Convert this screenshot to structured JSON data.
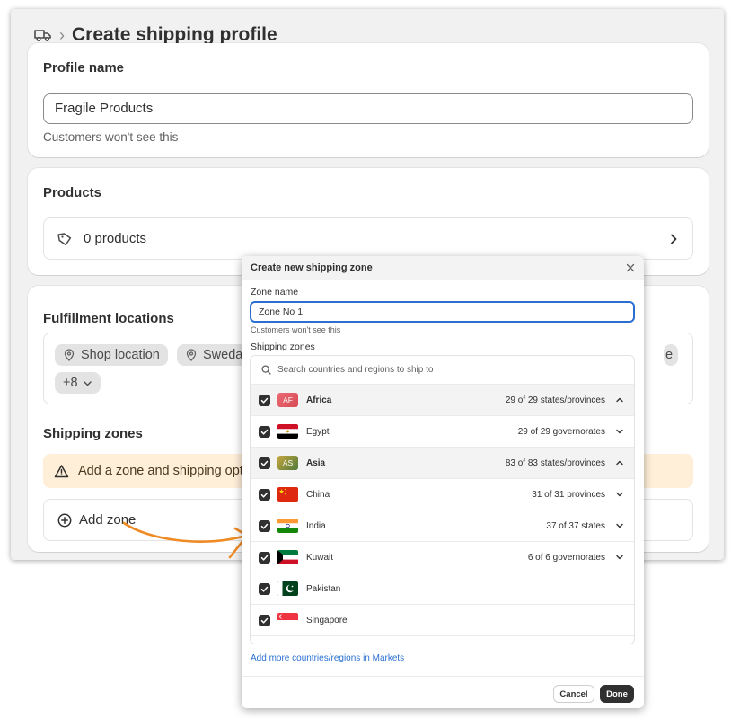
{
  "header": {
    "title": "Create shipping profile",
    "icon": "truck-icon"
  },
  "profile_card": {
    "title": "Profile name",
    "input_value": "Fragile Products",
    "help_text": "Customers won't see this"
  },
  "products_card": {
    "title": "Products",
    "count_label": "0 products"
  },
  "fulfillment_card": {
    "title": "Fulfillment locations",
    "chips": [
      "Shop location",
      "Sweda",
      "e"
    ],
    "more_chip": "+8",
    "zones_title": "Shipping zones",
    "warning_text": "Add a zone and shipping opt",
    "add_zone_label": "Add zone"
  },
  "modal": {
    "title": "Create new shipping zone",
    "zone_name_label": "Zone name",
    "zone_name_value": "Zone No 1",
    "zone_name_help": "Customers won't see this",
    "zones_label": "Shipping zones",
    "search_placeholder": "Search countries and regions to ship to",
    "rows": [
      {
        "name": "Africa",
        "badge": "AF",
        "count": "29 of 29 states/provinces",
        "region": true,
        "expanded": true
      },
      {
        "name": "Egypt",
        "flag": "egypt",
        "count": "29 of 29 governorates"
      },
      {
        "name": "Asia",
        "badge": "AS",
        "count": "83 of 83 states/provinces",
        "region": true,
        "expanded": true
      },
      {
        "name": "China",
        "flag": "china",
        "count": "31 of 31 provinces"
      },
      {
        "name": "India",
        "flag": "india",
        "count": "37 of 37 states"
      },
      {
        "name": "Kuwait",
        "flag": "kuwait",
        "count": "6 of 6 governorates"
      },
      {
        "name": "Pakistan",
        "flag": "pakistan",
        "count": ""
      },
      {
        "name": "Singapore",
        "flag": "singapore",
        "count": ""
      }
    ],
    "markets_link": "Add more countries/regions in Markets",
    "cancel_label": "Cancel",
    "done_label": "Done"
  },
  "colors": {
    "accent": "#2a6fd1",
    "warning_bg": "#ffefd9",
    "arrow": "#f08a24",
    "africa_badge": "#e4575f",
    "asia_badge": "#6c8a3a"
  }
}
